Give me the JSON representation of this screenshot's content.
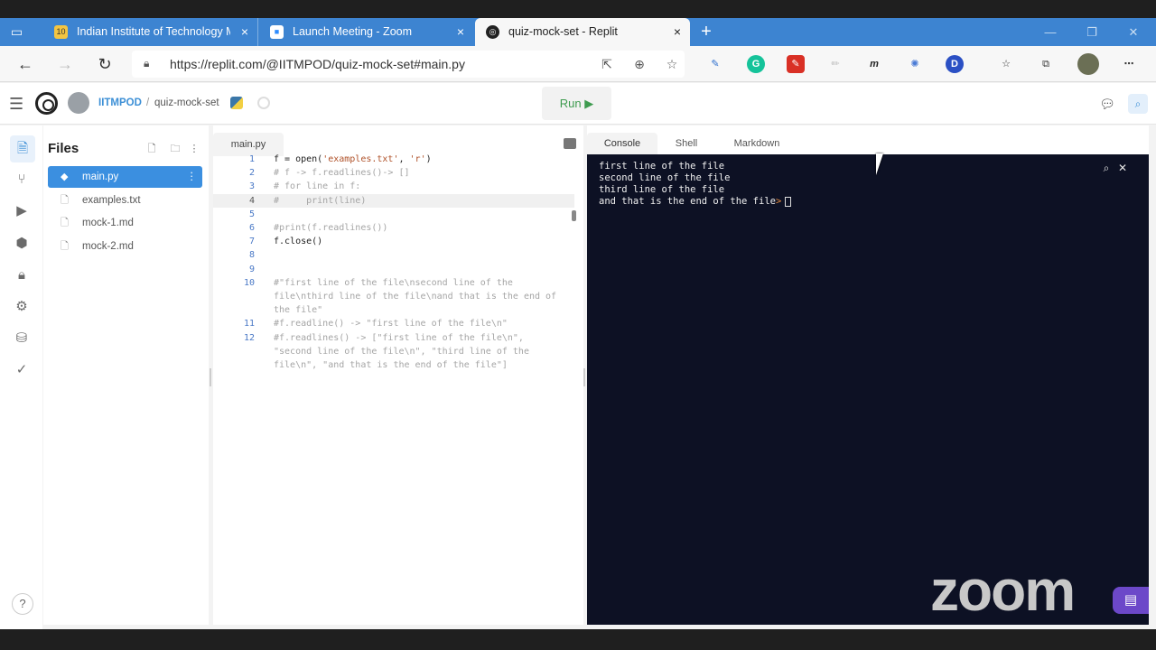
{
  "browser": {
    "tabs": [
      {
        "title": "Indian Institute of Technology M",
        "fav_text": "10",
        "close": "×"
      },
      {
        "title": "Launch Meeting - Zoom",
        "close": "×"
      },
      {
        "title": "quiz-mock-set - Replit",
        "close": "×"
      }
    ],
    "new_tab": "+",
    "window_controls": {
      "minimize": "—",
      "restore": "❐",
      "close": "✕"
    },
    "address": "https://replit.com/@IITMPOD/quiz-mock-set#main.py",
    "extensions": [
      "m",
      "D"
    ]
  },
  "replit": {
    "user": "IITMPOD",
    "separator": "/",
    "repl": "quiz-mock-set",
    "run_label": "Run ▶"
  },
  "files": {
    "title": "Files",
    "items": [
      "main.py",
      "examples.txt",
      "mock-1.md",
      "mock-2.md"
    ]
  },
  "editor": {
    "tab": "main.py",
    "lines": [
      {
        "n": "1",
        "segs": [
          {
            "t": "f = open(",
            "c": ""
          },
          {
            "t": "'examples.txt'",
            "c": "str"
          },
          {
            "t": ", ",
            "c": ""
          },
          {
            "t": "'r'",
            "c": "str"
          },
          {
            "t": ")",
            "c": ""
          }
        ]
      },
      {
        "n": "2",
        "segs": [
          {
            "t": "# f -> f.readlines()-> []",
            "c": "cmt"
          }
        ]
      },
      {
        "n": "3",
        "segs": [
          {
            "t": "# for line in f:",
            "c": "cmt"
          }
        ]
      },
      {
        "n": "4",
        "segs": [
          {
            "t": "#     print(line)",
            "c": "cmt"
          }
        ]
      },
      {
        "n": "5",
        "segs": []
      },
      {
        "n": "6",
        "segs": [
          {
            "t": "#print(f.readlines())",
            "c": "cmt"
          }
        ]
      },
      {
        "n": "7",
        "segs": [
          {
            "t": "f.close()",
            "c": ""
          }
        ]
      },
      {
        "n": "8",
        "segs": []
      },
      {
        "n": "9",
        "segs": []
      },
      {
        "n": "10",
        "segs": [
          {
            "t": "#\"first line of the file\\nsecond line of the",
            "c": "cmt"
          }
        ]
      },
      {
        "n": "",
        "segs": [
          {
            "t": "file\\nthird line of the file\\nand that is the end of",
            "c": "cmt"
          }
        ]
      },
      {
        "n": "",
        "segs": [
          {
            "t": "the file\"",
            "c": "cmt"
          }
        ]
      },
      {
        "n": "11",
        "segs": [
          {
            "t": "#f.readline() -> \"first line of the file\\n\"",
            "c": "cmt"
          }
        ]
      },
      {
        "n": "12",
        "segs": [
          {
            "t": "#f.readlines() -> [\"first line of the file\\n\",",
            "c": "cmt"
          }
        ]
      },
      {
        "n": "",
        "segs": [
          {
            "t": "\"second line of the file\\n\", \"third line of the",
            "c": "cmt"
          }
        ]
      },
      {
        "n": "",
        "segs": [
          {
            "t": "file\\n\", \"and that is the end of the file\"]",
            "c": "cmt"
          }
        ]
      }
    ]
  },
  "right_panel": {
    "tabs": [
      "Console",
      "Shell",
      "Markdown"
    ],
    "console_lines": [
      "first line of the file",
      "second line of the file",
      "third line of the file"
    ],
    "last_line": "and that is the end of the file",
    "prompt": ">"
  },
  "overlay": {
    "zoom_logo": "zoom"
  }
}
